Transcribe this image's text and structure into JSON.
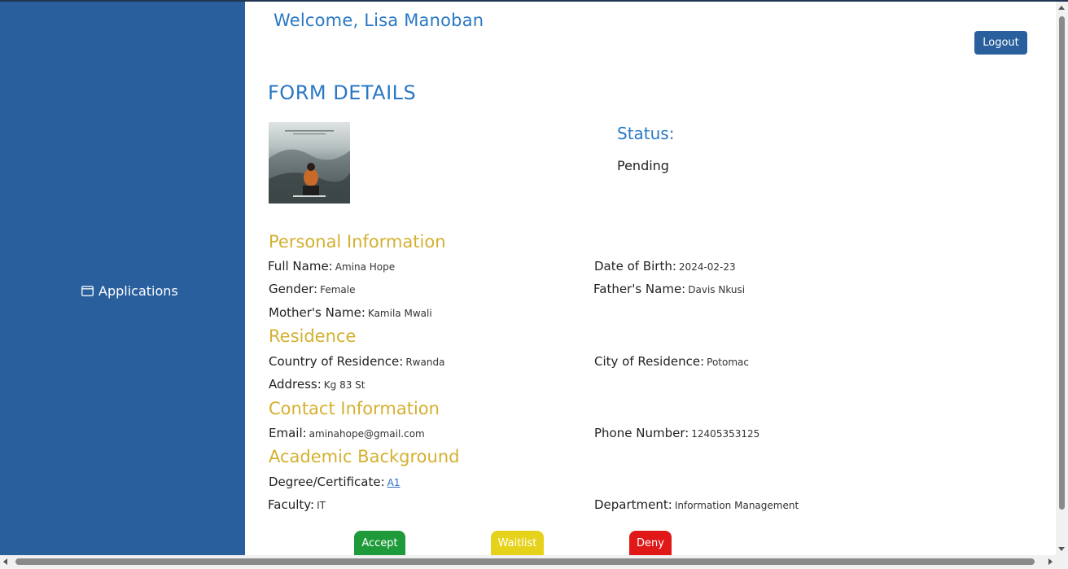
{
  "sidebar": {
    "applications_label": "Applications"
  },
  "header": {
    "welcome": "Welcome, Lisa Manoban",
    "logout_label": "Logout"
  },
  "form": {
    "title": "FORM DETAILS",
    "status_label": "Status:",
    "status_value": "Pending"
  },
  "sections": {
    "personal": "Personal Information",
    "residence": "Residence",
    "contact": "Contact Information",
    "academic": "Academic Background"
  },
  "fields": {
    "full_name": {
      "label": "Full Name:",
      "value": "Amina Hope"
    },
    "dob": {
      "label": "Date of Birth:",
      "value": "2024-02-23"
    },
    "gender": {
      "label": "Gender:",
      "value": "Female"
    },
    "father": {
      "label": "Father's Name:",
      "value": "Davis Nkusi"
    },
    "mother": {
      "label": "Mother's Name:",
      "value": "Kamila Mwali"
    },
    "country": {
      "label": "Country of Residence:",
      "value": "Rwanda"
    },
    "city": {
      "label": "City of Residence:",
      "value": "Potomac"
    },
    "address": {
      "label": "Address:",
      "value": "Kg 83 St"
    },
    "email": {
      "label": "Email:",
      "value": "aminahope@gmail.com"
    },
    "phone": {
      "label": "Phone Number:",
      "value": "12405353125"
    },
    "degree": {
      "label": "Degree/Certificate:",
      "value": "A1"
    },
    "faculty": {
      "label": "Faculty:",
      "value": "IT"
    },
    "department": {
      "label": "Department:",
      "value": "Information Management"
    }
  },
  "actions": {
    "accept": "Accept",
    "waitlist": "Waitlist",
    "deny": "Deny"
  },
  "colors": {
    "sidebar": "#2a5f9e",
    "accent": "#2a78c4",
    "section": "#d4b030",
    "accept": "#1f9a3a",
    "waitlist": "#e6d21a",
    "deny": "#e01818"
  },
  "icons": {
    "applications": "window-icon"
  }
}
